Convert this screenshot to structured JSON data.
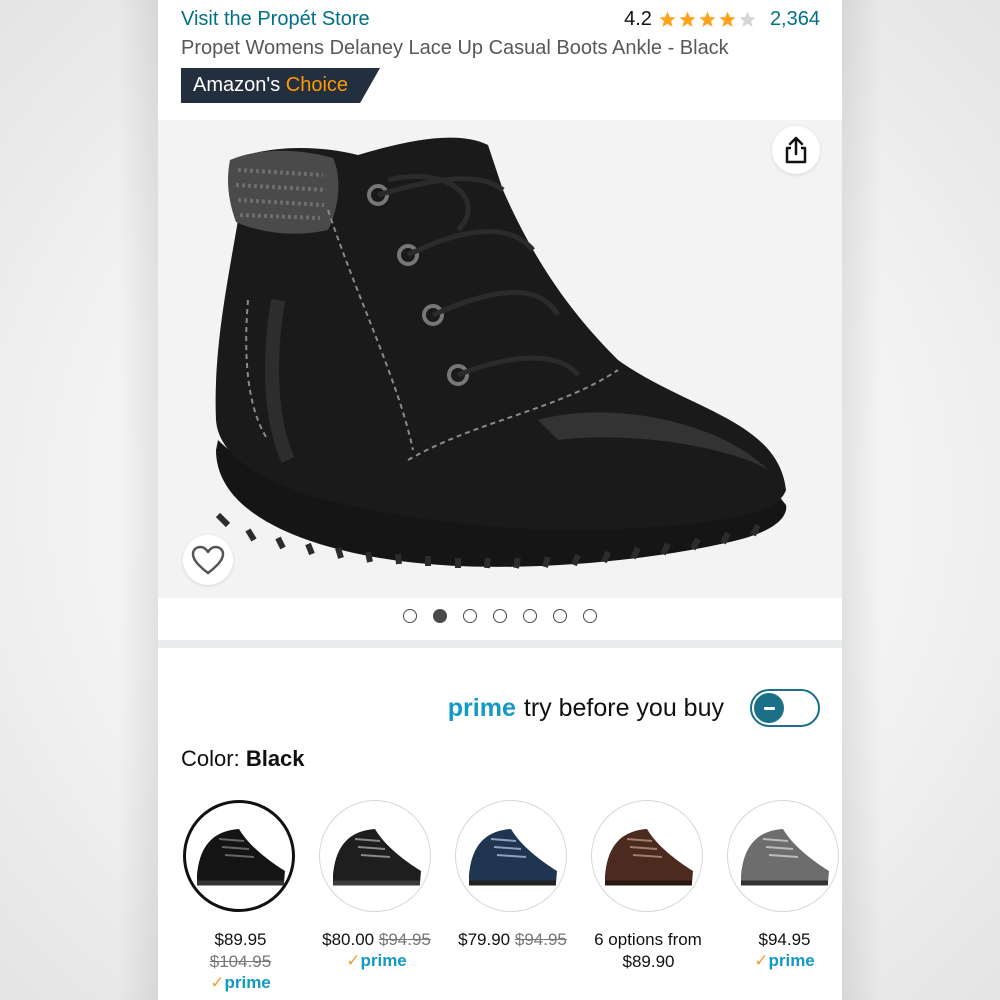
{
  "header": {
    "store_link": "Visit the Propét Store",
    "rating": "4.2",
    "stars_filled": 4,
    "stars_total": 5,
    "review_count": "2,364",
    "title": "Propet Womens Delaney Lace Up Casual Boots Ankle - Black",
    "badge_amazon": "Amazon's",
    "badge_choice": "Choice"
  },
  "gallery": {
    "image_count": 7,
    "active_index": 1,
    "share_icon": "share-icon",
    "wishlist_icon": "heart-icon"
  },
  "prime_try": {
    "prime_word": "prime",
    "text": "try before you buy",
    "toggle_state": "off"
  },
  "color": {
    "label": "Color:",
    "value": "Black"
  },
  "swatches": [
    {
      "name": "black-leather",
      "price": "$89.95",
      "was": "$104.95",
      "prime": "prime",
      "check": "✓"
    },
    {
      "name": "black-suede",
      "price": "$80.00",
      "was": "$94.95",
      "prime": "prime",
      "check": "✓"
    },
    {
      "name": "navy-suede",
      "price": "$79.90",
      "was": "$94.95",
      "prime": "",
      "check": ""
    },
    {
      "name": "brown-suede",
      "price": "6 options from",
      "price2": "$89.90",
      "prime": "",
      "check": ""
    },
    {
      "name": "grey",
      "price": "$94.95",
      "prime": "prime",
      "check": "✓"
    }
  ],
  "colors": {
    "link": "#007185",
    "prime_blue": "#1399c6",
    "star": "#ffa41c",
    "badge_bg": "#232f3e",
    "badge_choice": "#ff9900",
    "toggle": "#1b6f86"
  }
}
